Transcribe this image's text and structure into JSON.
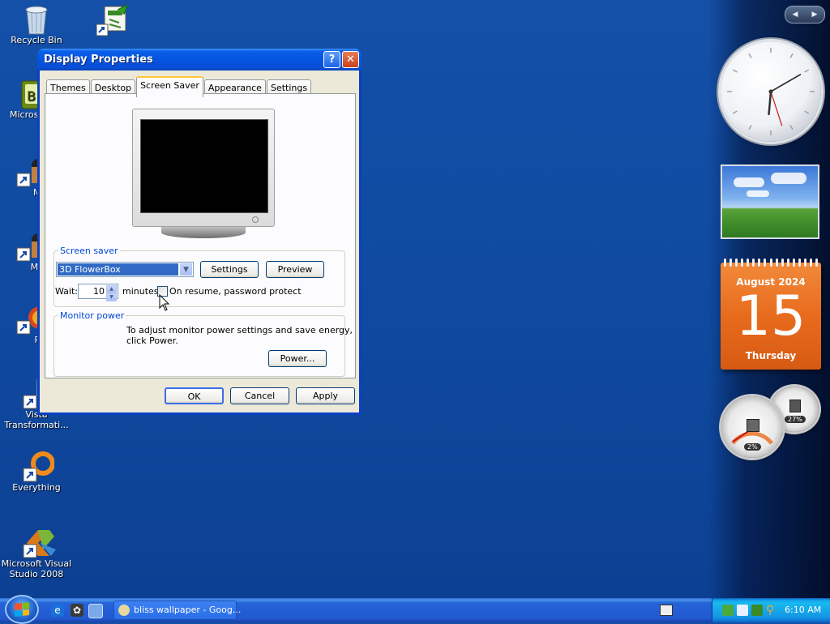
{
  "desktop": {
    "icons": [
      {
        "id": "recycle",
        "label": "Recycle Bin"
      },
      {
        "id": "network",
        "label": ""
      },
      {
        "id": "ms-office",
        "label": "Microsoft"
      },
      {
        "id": "my-1",
        "label": "My"
      },
      {
        "id": "my-2",
        "label": "MyP"
      },
      {
        "id": "pe",
        "label": "Pe"
      },
      {
        "id": "vista",
        "label": "Vista Transformati..."
      },
      {
        "id": "everything",
        "label": "Everything"
      },
      {
        "id": "vs2008",
        "label": "Microsoft Visual Studio 2008"
      }
    ]
  },
  "dialog": {
    "title": "Display Properties",
    "help_glyph": "?",
    "close_glyph": "✕",
    "tabs": [
      "Themes",
      "Desktop",
      "Screen Saver",
      "Appearance",
      "Settings"
    ],
    "active_tab": "Screen Saver",
    "screensaver": {
      "group_label": "Screen saver",
      "selected": "3D FlowerBox",
      "settings_label": "Settings",
      "preview_label": "Preview",
      "wait_label": "Wait:",
      "wait_value": "10",
      "minutes_label": "minutes",
      "password_label": "On resume, password protect",
      "password_checked": false
    },
    "monitor_power": {
      "group_label": "Monitor power",
      "text_line1": "To adjust monitor power settings and save energy,",
      "text_line2": "click Power.",
      "power_label": "Power..."
    },
    "ok_label": "OK",
    "cancel_label": "Cancel",
    "apply_label": "Apply"
  },
  "sidebar": {
    "nav_prev": "◀",
    "nav_next": "▶",
    "clock": {
      "hour": 6,
      "minute": 10,
      "second": 27
    },
    "calendar": {
      "month": "August 2024",
      "day": "15",
      "weekday": "Thursday"
    },
    "cpu_meter": {
      "cpu": "2%",
      "memory": "27%"
    }
  },
  "taskbar": {
    "task_label": "bliss wallpaper - Goog...",
    "time": "6:10 AM"
  },
  "colors": {
    "desktop_bg": "#1450a8",
    "title_blue": "#0554e0",
    "calendar_orange": "#e86b1d",
    "link_blue": "#0046d5"
  }
}
